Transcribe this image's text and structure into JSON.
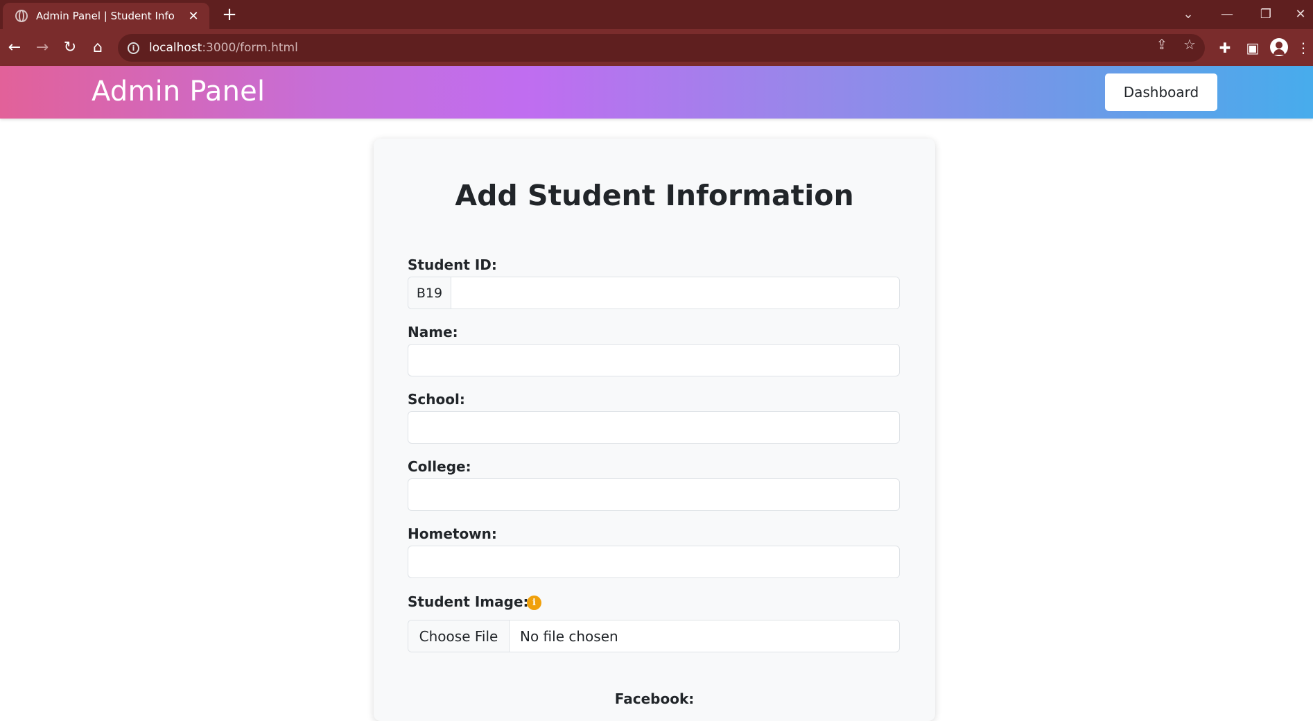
{
  "browser": {
    "tab_title": "Admin Panel | Student Info",
    "tab_close": "✕",
    "new_tab": "+",
    "url_host": "localhost",
    "url_path": ":3000/form.html"
  },
  "navbar": {
    "brand": "Admin Panel",
    "dashboard_label": "Dashboard"
  },
  "form": {
    "title": "Add Student Information",
    "student_id": {
      "label": "Student ID:",
      "prefix": "B19",
      "value": ""
    },
    "name": {
      "label": "Name:",
      "value": ""
    },
    "school": {
      "label": "School:",
      "value": ""
    },
    "college": {
      "label": "College:",
      "value": ""
    },
    "hometown": {
      "label": "Hometown:",
      "value": ""
    },
    "image": {
      "label": "Student Image:",
      "button": "Choose File",
      "status": "No file chosen",
      "info_glyph": "i"
    },
    "facebook": {
      "label": "Facebook:"
    }
  },
  "colors": {
    "chrome_dark": "#5f1f1f",
    "chrome_toolbar": "#7a2c2c",
    "info_badge": "#f0a00a"
  }
}
